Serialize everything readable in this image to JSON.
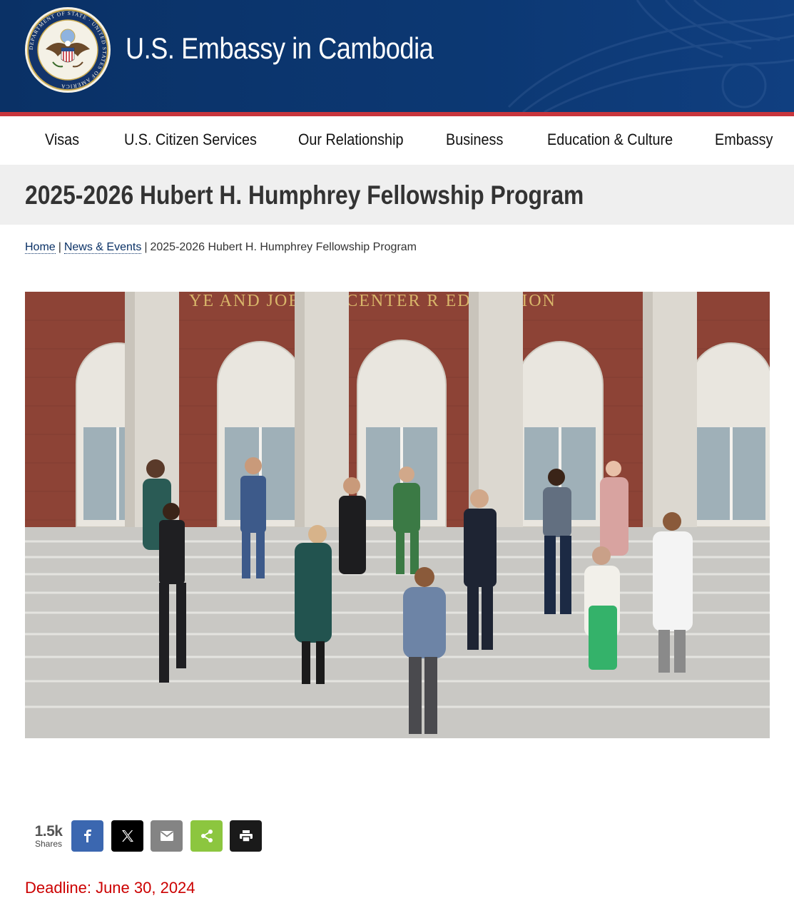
{
  "header": {
    "site_title": "U.S. Embassy in Cambodia",
    "seal_text": "DEPARTMENT OF STATE · UNITED STATES OF AMERICA"
  },
  "nav": {
    "items": [
      {
        "label": "Visas"
      },
      {
        "label": "U.S. Citizen Services"
      },
      {
        "label": "Our Relationship"
      },
      {
        "label": "Business"
      },
      {
        "label": "Education & Culture"
      },
      {
        "label": "Embassy"
      }
    ]
  },
  "page": {
    "title": "2025-2026 Hubert H. Humphrey Fellowship Program"
  },
  "breadcrumb": {
    "home": "Home",
    "separator": "|",
    "news": "News & Events",
    "current": "2025-2026 Hubert H. Humphrey Fellowship Program"
  },
  "hero": {
    "building_inscription": "YE AND JOE  ATT CENTER  R EDUCATION"
  },
  "share": {
    "count": "1.5k",
    "label": "Shares",
    "buttons": [
      {
        "icon": "facebook-icon",
        "color": "#3b67b0"
      },
      {
        "icon": "x-icon",
        "color": "#000000"
      },
      {
        "icon": "email-icon",
        "color": "#848484"
      },
      {
        "icon": "share-icon",
        "color": "#8cc63f"
      },
      {
        "icon": "print-icon",
        "color": "#1a1a1a"
      }
    ]
  },
  "content": {
    "deadline": "Deadline: June 30, 2024"
  },
  "colors": {
    "header_blue": "#0c3873",
    "accent_red": "#c8353c",
    "deadline_red": "#cc0000"
  }
}
